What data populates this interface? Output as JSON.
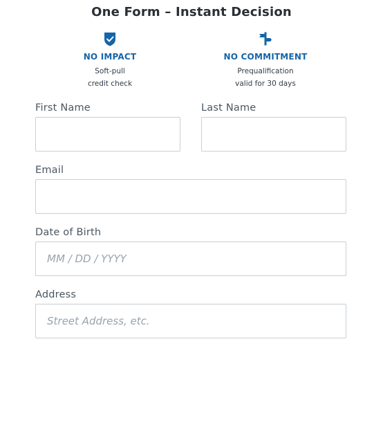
{
  "header": {
    "title": "One Form – Instant Decision"
  },
  "features": [
    {
      "icon": "shield-check-icon",
      "title": "NO IMPACT",
      "desc_line1": "Soft-pull",
      "desc_line2": "credit check"
    },
    {
      "icon": "signpost-icon",
      "title": "NO COMMITMENT",
      "desc_line1": "Prequalification",
      "desc_line2": "valid for 30 days"
    }
  ],
  "form": {
    "first_name": {
      "label": "First Name",
      "value": "",
      "placeholder": ""
    },
    "last_name": {
      "label": "Last Name",
      "value": "",
      "placeholder": ""
    },
    "email": {
      "label": "Email",
      "value": "",
      "placeholder": ""
    },
    "dob": {
      "label": "Date of Birth",
      "value": "",
      "placeholder": "MM / DD / YYYY"
    },
    "address": {
      "label": "Address",
      "value": "",
      "placeholder": "Street Address, etc."
    }
  },
  "colors": {
    "accent": "#1565a8",
    "title_text": "#2a2f36",
    "label_text": "#4a5661",
    "border": "#c9cfd5"
  }
}
